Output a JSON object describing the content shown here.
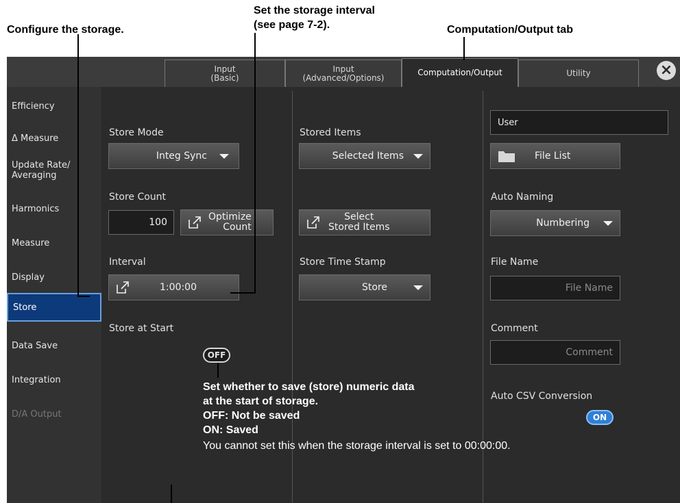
{
  "callouts": {
    "configure": "Configure the storage.",
    "interval_line1": "Set the storage interval",
    "interval_line2": "(see page 7-2).",
    "tab": "Computation/Output tab",
    "start_line1": "Set whether to save (store) numeric data",
    "start_line2": "at the start of storage.",
    "start_line3": "OFF: Not be saved",
    "start_line4": "ON: Saved",
    "note": "You cannot set this when the storage interval is set to 00:00:00."
  },
  "tabs": [
    {
      "line1": "Input",
      "line2": "(Basic)"
    },
    {
      "line1": "Input",
      "line2": "(Advanced/Options)"
    },
    {
      "line1": "Computation/Output",
      "line2": ""
    },
    {
      "line1": "Utility",
      "line2": ""
    }
  ],
  "sidebar": [
    {
      "label": "Efficiency"
    },
    {
      "label": "Δ Measure"
    },
    {
      "label": "Update Rate/",
      "label2": "Averaging"
    },
    {
      "label": "Harmonics"
    },
    {
      "label": "Measure"
    },
    {
      "label": "Display"
    },
    {
      "label": "Store"
    },
    {
      "label": "Data Save"
    },
    {
      "label": "Integration"
    },
    {
      "label": "D/A Output"
    }
  ],
  "col1": {
    "store_mode_label": "Store Mode",
    "store_mode_value": "Integ Sync",
    "store_count_label": "Store Count",
    "store_count_value": "100",
    "optimize_line1": "Optimize",
    "optimize_line2": "Count",
    "interval_label": "Interval",
    "interval_value": "1:00:00",
    "store_at_start_label": "Store at Start",
    "store_at_start_state": "OFF"
  },
  "col2": {
    "stored_items_label": "Stored Items",
    "stored_items_value": "Selected Items",
    "select_line1": "Select",
    "select_line2": "Stored Items",
    "time_stamp_label": "Store Time Stamp",
    "time_stamp_value": "Store"
  },
  "col3": {
    "folder_value": "User",
    "file_list_label": "File List",
    "auto_naming_label": "Auto Naming",
    "auto_naming_value": "Numbering",
    "file_name_label": "File Name",
    "file_name_placeholder": "File Name",
    "comment_label": "Comment",
    "comment_placeholder": "Comment",
    "auto_csv_label": "Auto CSV Conversion",
    "auto_csv_state": "ON"
  }
}
